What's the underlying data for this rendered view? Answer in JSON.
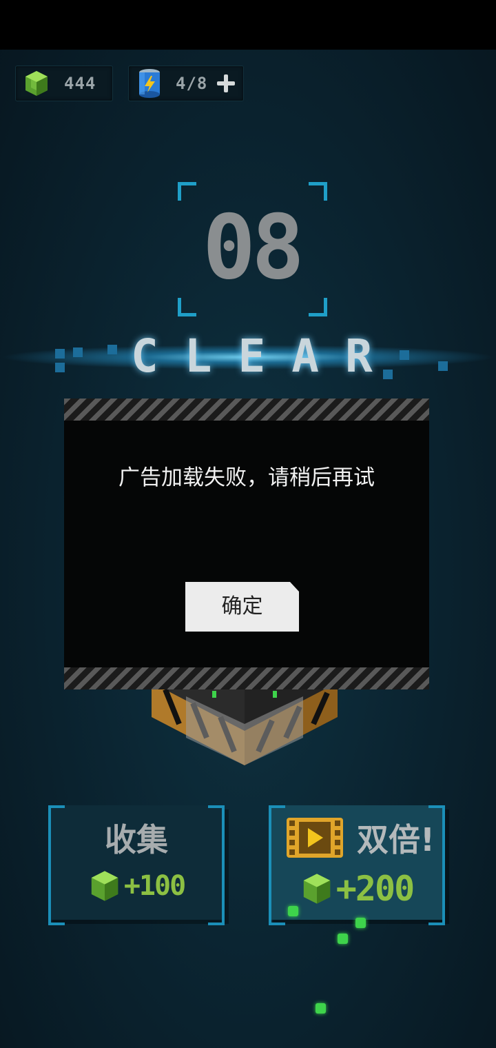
{
  "resources": {
    "gems": "444",
    "energy": "4/8"
  },
  "level": {
    "number": "08",
    "banner": "CLEAR"
  },
  "dialog": {
    "message": "广告加载失败，请稍后再试",
    "confirm_label": "确定"
  },
  "rewards": {
    "collect_label": "收集",
    "collect_amount": "+100",
    "double_label": "双倍!",
    "double_amount": "+200"
  },
  "colors": {
    "accent": "#1f9fc8",
    "reward_green": "#8cc043",
    "background": "#0b2532"
  },
  "icons": [
    "gem-icon",
    "battery-icon",
    "plus-icon",
    "video-icon"
  ]
}
